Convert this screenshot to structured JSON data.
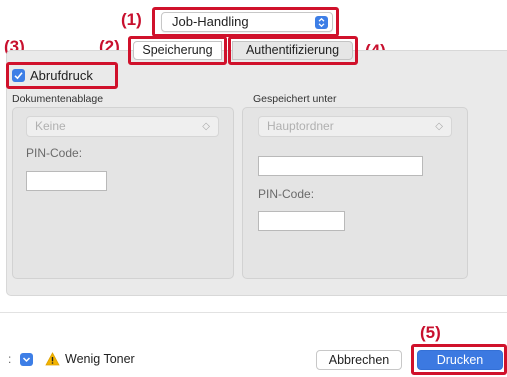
{
  "annotations": [
    "(1)",
    "(2)",
    "(3)",
    "(4)",
    "(5)"
  ],
  "popup": {
    "value": "Job-Handling",
    "icon": "up-down-stepper-icon"
  },
  "tabs": [
    {
      "label": "Speicherung"
    },
    {
      "label": "Authentifizierung"
    }
  ],
  "checkbox": {
    "label": "Abrufdruck",
    "checked": true
  },
  "left_section": {
    "title": "Dokumentenablage",
    "select_value": "Keine",
    "pin_label": "PIN-Code:"
  },
  "right_section": {
    "title": "Gespeichert unter",
    "select_value": "Hauptordner",
    "pin_label": "PIN-Code:"
  },
  "bottom": {
    "warning_text": "Wenig Toner",
    "cancel_label": "Abbrechen",
    "print_label": "Drucken",
    "left_marker": ":"
  },
  "colors": {
    "accent": "#3c79e1",
    "highlight": "#d0112b",
    "warning": "#f2b300"
  }
}
